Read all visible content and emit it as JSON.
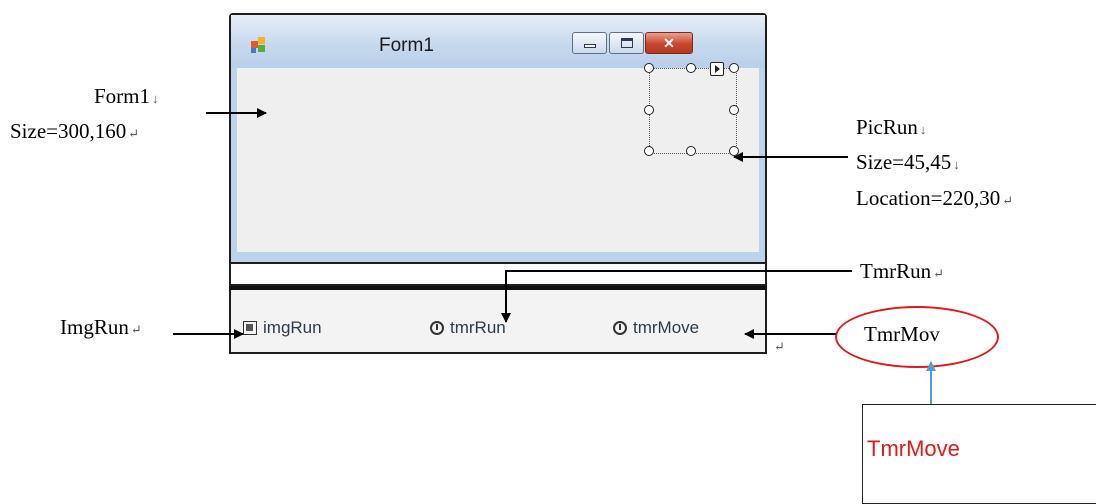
{
  "form": {
    "title": "Form1",
    "close_glyph": "✕"
  },
  "tray": {
    "components": [
      {
        "label": "imgRun"
      },
      {
        "label": "tmrRun"
      },
      {
        "label": "tmrMove"
      }
    ]
  },
  "annotations": {
    "form1": {
      "name": "Form1",
      "size": "Size=300,160"
    },
    "picrun": {
      "name": "PicRun",
      "size": "Size=45,45",
      "location": "Location=220,30"
    },
    "tmrrun": "TmrRun",
    "imgrun": "ImgRun",
    "tmrmov": "TmrMov",
    "callout": "TmrMove",
    "marks": {
      "down": "↓",
      "return": "↵"
    }
  },
  "colors": {
    "callout_red": "#e01a1a",
    "callout_arrow_blue": "#5b9bd5",
    "title_bar": "#c7d9ee",
    "close_button": "#c8462d"
  },
  "icons": {
    "app": "form-app-icon",
    "image_component": "image-list-icon",
    "timer_component": "stopwatch-icon"
  }
}
